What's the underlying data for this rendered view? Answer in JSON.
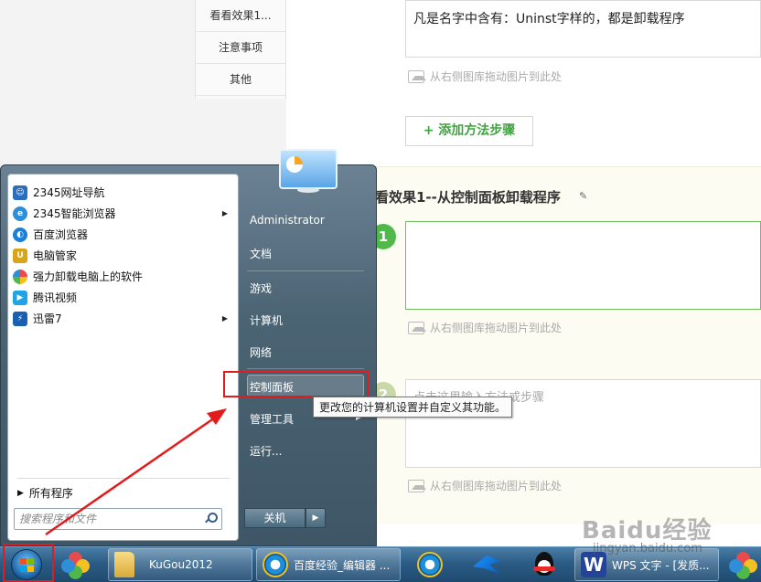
{
  "left_nav": {
    "items": [
      "看看效果1...",
      "注意事项",
      "其他"
    ]
  },
  "editor": {
    "step_text": "凡是名字中含有：Uninst字样的，都是卸载程序",
    "drop_hint": "从右侧图库拖动图片到此处",
    "add_step": "+ 添加方法步骤",
    "section_title": "看效果1--从控制面板卸载程序",
    "step1_num": "1",
    "step2_num": "2",
    "step2_placeholder": "点击这里输入方法或步骤"
  },
  "start_menu": {
    "programs": [
      {
        "label": "2345网址导航",
        "icon": "globe-icon",
        "color": "#2a6ebd"
      },
      {
        "label": "2345智能浏览器",
        "icon": "browser-icon",
        "color": "#2f8ed8",
        "has_submenu": true
      },
      {
        "label": "百度浏览器",
        "icon": "baidu-browser-icon",
        "color": "#1a7fd6"
      },
      {
        "label": "电脑管家",
        "icon": "shield-icon",
        "color": "#d9a41a"
      },
      {
        "label": "强力卸载电脑上的软件",
        "icon": "clover-icon",
        "color": "#6cc04a"
      },
      {
        "label": "腾讯视频",
        "icon": "play-icon",
        "color": "#1fa4e8"
      },
      {
        "label": "迅雷7",
        "icon": "thunder-icon",
        "color": "#1b5fb3",
        "has_submenu": true
      }
    ],
    "all_programs": "所有程序",
    "search_placeholder": "搜索程序和文件",
    "right_items": {
      "user": "Administrator",
      "documents": "文档",
      "games": "游戏",
      "computer": "计算机",
      "network": "网络",
      "control_panel": "控制面板",
      "admin_tools": "管理工具",
      "run": "运行..."
    },
    "shutdown": "关机",
    "tooltip": "更改您的计算机设置并自定义其功能。"
  },
  "taskbar": {
    "kugou": "KuGou2012",
    "baidu_editor": "百度经验_编辑器 ...",
    "wps": "WPS 文字 - [发质..."
  },
  "watermark": {
    "brand": "Baidu经验",
    "url": "jingyan.baidu.com"
  },
  "colors": {
    "highlight_red": "#e21b1b",
    "step_green": "#50b94a",
    "taskbar_blue": "#2b5c85"
  }
}
